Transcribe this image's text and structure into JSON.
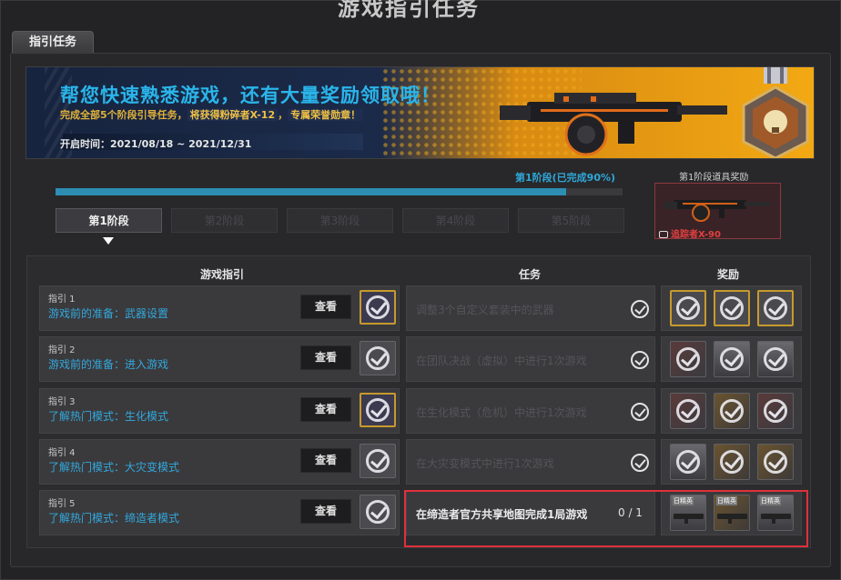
{
  "window": {
    "title": "游戏指引任务"
  },
  "tab": {
    "label": "指引任务"
  },
  "banner": {
    "headline": "帮您快速熟悉游戏，还有大量奖励领取哦！",
    "sub_prefix": "完成全部5个阶段引导任务，",
    "sub_highlight1": "将获得粉碎者X-12",
    "sub_sep": "，",
    "sub_highlight2": "专属荣誉勋章！",
    "time": "开启时间：2021/08/18 ~ 2021/12/31"
  },
  "progress": {
    "label": "第1阶段(已完成90%)",
    "fraction": 0.9
  },
  "stages": [
    {
      "label": "第1阶段",
      "active": true
    },
    {
      "label": "第2阶段",
      "active": false
    },
    {
      "label": "第3阶段",
      "active": false
    },
    {
      "label": "第4阶段",
      "active": false
    },
    {
      "label": "第5阶段",
      "active": false
    }
  ],
  "stage_reward": {
    "title": "第1阶段道具奖励",
    "name": "追踪者X-90"
  },
  "table": {
    "headers": {
      "guide": "游戏指引",
      "task": "任务",
      "reward": "奖励"
    },
    "view_label": "查看",
    "rows": [
      {
        "num": "指引 1",
        "text": "游戏前的准备：武器设置",
        "task": "调整3个自定义套装中的武器",
        "done": true
      },
      {
        "num": "指引 2",
        "text": "游戏前的准备：进入游戏",
        "task": "在团队决战（虚拟）中进行1次游戏",
        "done": true
      },
      {
        "num": "指引 3",
        "text": "了解热门模式：生化模式",
        "task": "在生化模式（危机）中进行1次游戏",
        "done": true
      },
      {
        "num": "指引 4",
        "text": "了解热门模式：大灾变模式",
        "task": "在大灾变模式中进行1次游戏",
        "done": true
      },
      {
        "num": "指引 5",
        "text": "了解热门模式：缔造者模式",
        "task": "在缔造者官方共享地图完成1局游戏",
        "progress": "0 / 1",
        "done": false
      }
    ],
    "reward_tag": "日精英"
  },
  "colors": {
    "accent_blue": "#33a8dc",
    "gold": "#c79a2c",
    "highlight_red": "#e0303a"
  }
}
